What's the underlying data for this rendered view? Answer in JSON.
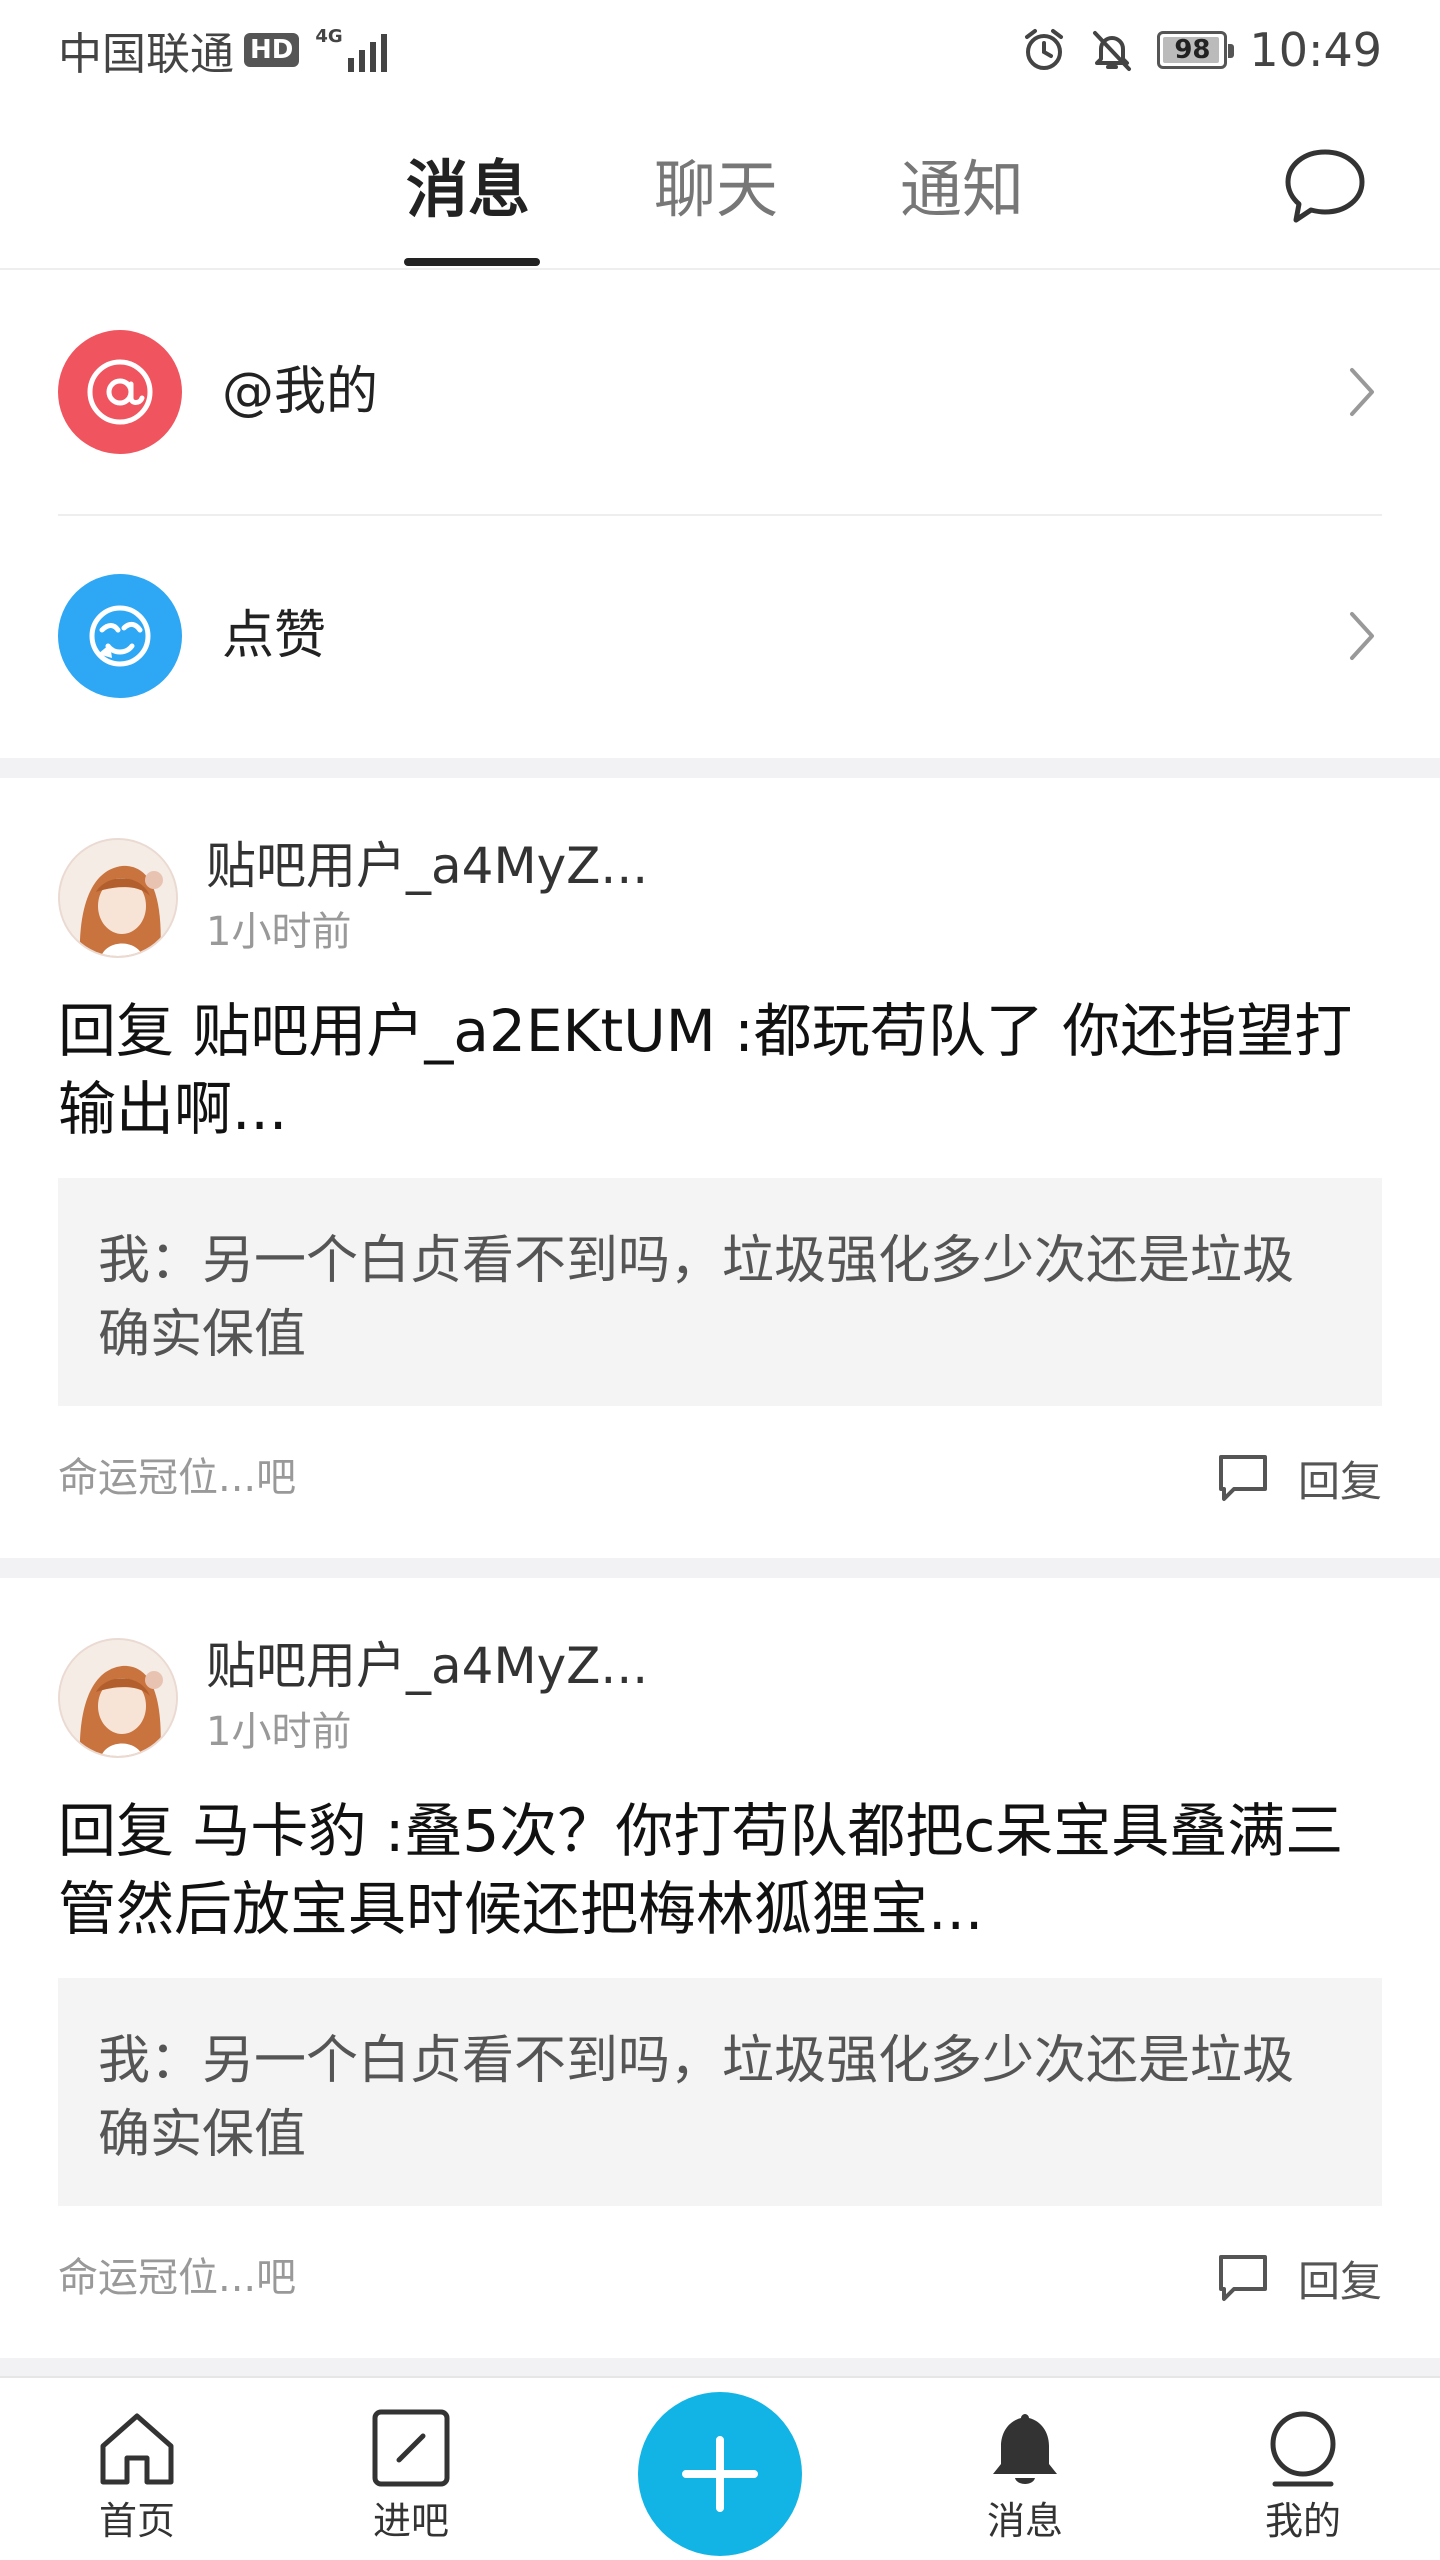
{
  "status_bar": {
    "carrier": "中国联通",
    "hd": "HD",
    "network": "4G",
    "battery": "98",
    "battery_level": 0.98,
    "time": "10:49"
  },
  "tabs": [
    {
      "label": "消息",
      "active": true
    },
    {
      "label": "聊天",
      "active": false
    },
    {
      "label": "通知",
      "active": false
    }
  ],
  "entries": [
    {
      "label": "@我的",
      "icon": "at-icon",
      "color": "#f0545f"
    },
    {
      "label": "点赞",
      "icon": "like-icon",
      "color": "#2ea7f4"
    }
  ],
  "replies": [
    {
      "username": "贴吧用户_a4MyZ...",
      "time": "1小时前",
      "text": "回复  贴吧用户_a2EKtUM :都玩苟队了  你还指望打输出啊...",
      "quote": "我：另一个白贞看不到吗，垃圾强化多少次还是垃圾确实保值",
      "forum": "命运冠位...吧",
      "reply_label": "回复"
    },
    {
      "username": "贴吧用户_a4MyZ...",
      "time": "1小时前",
      "text": "回复  马卡豹 :叠5次？你打苟队都把c呆宝具叠满三管然后放宝具时候还把梅林狐狸宝...",
      "quote": "我：另一个白贞看不到吗，垃圾强化多少次还是垃圾确实保值",
      "forum": "命运冠位...吧",
      "reply_label": "回复"
    }
  ],
  "bottom_nav": {
    "home": "首页",
    "enter_bar": "进吧",
    "messages": "消息",
    "mine": "我的"
  },
  "colors": {
    "accent": "#12b4e6",
    "at_red": "#f0545f",
    "like_blue": "#2ea7f4"
  }
}
